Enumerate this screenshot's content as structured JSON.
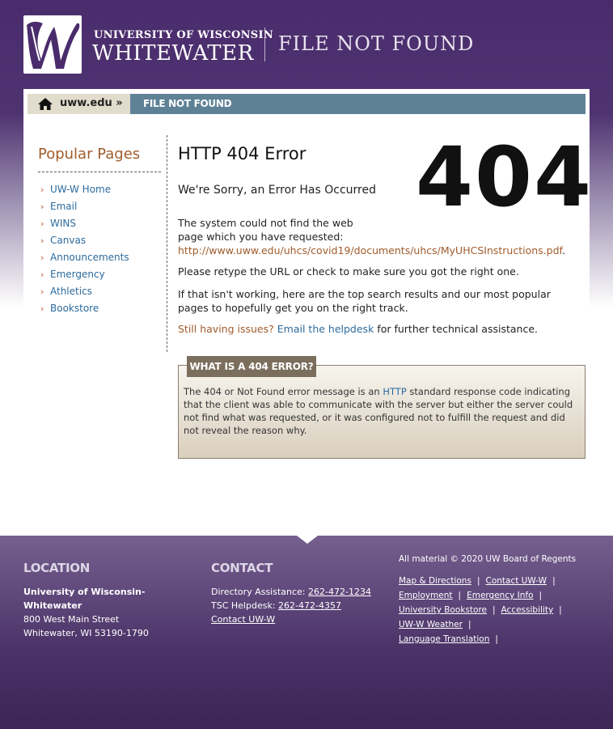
{
  "header": {
    "university_line1": "UNIVERSITY OF WISCONSIN",
    "university_line2": "WHITEWATER",
    "page_heading": "FILE NOT FOUND"
  },
  "breadcrumb": {
    "home_label": "uww.edu »",
    "current_label": "FILE NOT FOUND"
  },
  "sidebar": {
    "title": "Popular Pages",
    "items": [
      {
        "label": "UW-W Home"
      },
      {
        "label": "Email"
      },
      {
        "label": "WINS"
      },
      {
        "label": "Canvas"
      },
      {
        "label": "Announcements"
      },
      {
        "label": "Emergency"
      },
      {
        "label": "Athletics"
      },
      {
        "label": "Bookstore"
      }
    ],
    "bullet": "›"
  },
  "main": {
    "error_title": "HTTP 404 Error",
    "big_code": "404",
    "subtitle": "We're Sorry, an Error Has Occurred",
    "p1_text": "The system could not find the web page which you have requested:",
    "p1_url": "http://www.uww.edu/uhcs/covid19/documents/uhcs/MyUHCSInstructions.pdf",
    "p1_end": ".",
    "p2": "Please retype the URL or check to make sure you got the right one.",
    "p3": "If that isn't working, here are the top search results and our most popular pages to hopefully get you on the right track.",
    "p4_issue": "Still having issues?",
    "p4_link": "Email the helpdesk",
    "p4_tail": "for further technical assistance."
  },
  "infobox": {
    "tab_label": "WHAT IS A 404 ERROR?",
    "text_before": "The 404 or Not Found error message is an",
    "link": "HTTP",
    "text_after": "standard response code indicating that the client was able to communicate with the server but either the server could not find what was requested, or it was configured not to fulfill the request and did not reveal the reason why."
  },
  "footer": {
    "location": {
      "heading": "LOCATION",
      "name": "University of Wisconsin-Whitewater",
      "street": "800 West Main Street",
      "city": "Whitewater, WI 53190-1790"
    },
    "contact": {
      "heading": "CONTACT",
      "dir_label": "Directory Assistance:",
      "dir_phone": "262-472-1234",
      "tsc_label": "TSC Helpdesk:",
      "tsc_phone": "262-472-4357",
      "contact_link": "Contact UW-W"
    },
    "copyright": "All material © 2020 UW Board of Regents",
    "links": [
      "Map & Directions",
      "Contact UW-W",
      "Employment",
      "Emergency Info",
      "University Bookstore",
      "Accessibility",
      "UW-W Weather",
      "Language Translation"
    ],
    "separator": "|"
  },
  "colors": {
    "purple": "#4a2c6c",
    "link_blue": "#2c6b9e",
    "accent_orange": "#a05c2c",
    "crumb_blue": "#5f8196",
    "tab_brown": "#7b6e5d"
  }
}
